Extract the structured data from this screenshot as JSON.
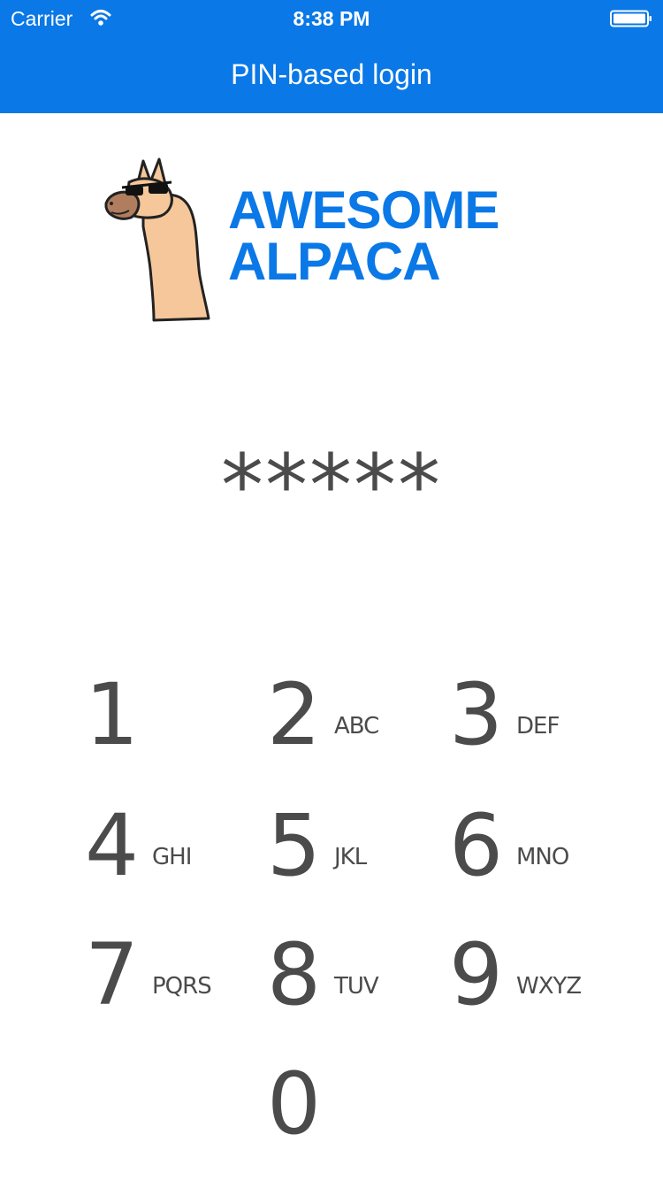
{
  "status_bar": {
    "carrier": "Carrier",
    "time": "8:38 PM"
  },
  "nav": {
    "title": "PIN-based login"
  },
  "logo": {
    "line1": "AWESOME",
    "line2": "ALPACA",
    "color": "#0a78e6"
  },
  "pin": {
    "masked": "*****"
  },
  "keypad": [
    {
      "digit": "1",
      "letters": ""
    },
    {
      "digit": "2",
      "letters": "ABC"
    },
    {
      "digit": "3",
      "letters": "DEF"
    },
    {
      "digit": "4",
      "letters": "GHI"
    },
    {
      "digit": "5",
      "letters": "JKL"
    },
    {
      "digit": "6",
      "letters": "MNO"
    },
    {
      "digit": "7",
      "letters": "PQRS"
    },
    {
      "digit": "8",
      "letters": "TUV"
    },
    {
      "digit": "9",
      "letters": "WXYZ"
    },
    {
      "digit": "0",
      "letters": ""
    }
  ]
}
